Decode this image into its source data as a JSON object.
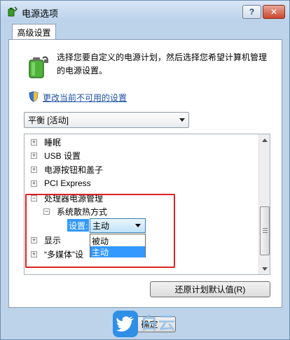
{
  "window": {
    "title": "电源选项",
    "help_label": "?",
    "close_label": "✕"
  },
  "tab": {
    "label": "高级设置"
  },
  "description": "选择您要自定义的电源计划，然后选择您希望计算机管理的电源设置。",
  "change_link": "更改当前不可用的设置",
  "plan_select": {
    "value": "平衡 [活动]"
  },
  "tree": {
    "items": [
      {
        "label": "睡眠",
        "expander": "+"
      },
      {
        "label": "USB 设置",
        "expander": "+"
      },
      {
        "label": "电源按钮和盖子",
        "expander": "+"
      },
      {
        "label": "PCI Express",
        "expander": "+"
      },
      {
        "label": "处理器电源管理",
        "expander": "−"
      },
      {
        "label": "系统散热方式",
        "expander": "−"
      },
      {
        "label": "显示",
        "expander": "+"
      },
      {
        "label": "“多媒体”设",
        "expander": "+"
      }
    ],
    "setting_label": "设置:",
    "setting_value": "主动",
    "dropdown_options": [
      "被动",
      "主动"
    ],
    "dropdown_selected": "主动"
  },
  "buttons": {
    "restore": "还原计划默认值(R)",
    "ok": "确定"
  },
  "watermark": {
    "text": "白云"
  },
  "colors": {
    "highlight": "#3399ff",
    "annotation_box": "#e02020",
    "link": "#1e51a0",
    "watermark": "#2f8fe6"
  },
  "icons": [
    "power-options-icon",
    "help-icon",
    "close-icon",
    "battery-icon",
    "shield-icon",
    "chevron-down-icon",
    "expand-icon",
    "collapse-icon",
    "scroll-up-icon",
    "scroll-down-icon",
    "bird-logo-icon"
  ]
}
